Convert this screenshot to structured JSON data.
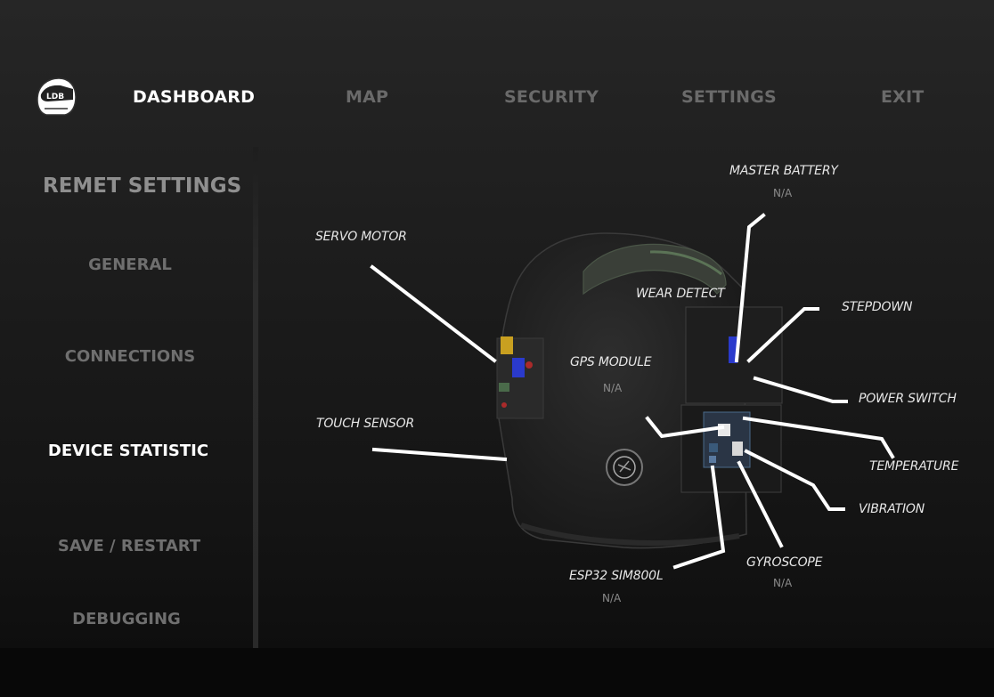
{
  "nav": {
    "items": [
      {
        "label": "DASHBOARD",
        "active": true
      },
      {
        "label": "MAP",
        "active": false
      },
      {
        "label": "SECURITY",
        "active": false
      },
      {
        "label": "SETTINGS",
        "active": false
      },
      {
        "label": "EXIT",
        "active": false
      }
    ]
  },
  "logo": {
    "icon": "helmet-logo-icon"
  },
  "sidebar": {
    "title": "REMET SETTINGS",
    "items": [
      {
        "label": "GENERAL",
        "active": false
      },
      {
        "label": "CONNECTIONS",
        "active": false
      },
      {
        "label": "DEVICE STATISTIC",
        "active": true
      },
      {
        "label": "SAVE / RESTART",
        "active": false
      },
      {
        "label": "DEBUGGING",
        "active": false
      }
    ]
  },
  "components": {
    "master_battery": {
      "label": "MASTER BATTERY",
      "value": "N/A"
    },
    "servo_motor": {
      "label": "SERVO MOTOR"
    },
    "wear_detect": {
      "label": "WEAR DETECT"
    },
    "stepdown": {
      "label": "STEPDOWN"
    },
    "gps_module": {
      "label": "GPS MODULE",
      "value": "N/A"
    },
    "power_switch": {
      "label": "POWER SWITCH"
    },
    "touch_sensor": {
      "label": "TOUCH SENSOR"
    },
    "temperature": {
      "label": "TEMPERATURE"
    },
    "vibration": {
      "label": "VIBRATION"
    },
    "gyroscope": {
      "label": "GYROSCOPE",
      "value": "N/A"
    },
    "esp32": {
      "label": "ESP32 SIM800L",
      "value": "N/A"
    }
  },
  "colors": {
    "background": "#1c1c1c",
    "active": "#ffffff",
    "inactive": "#6a6a6a",
    "leader": "#ffffff"
  }
}
